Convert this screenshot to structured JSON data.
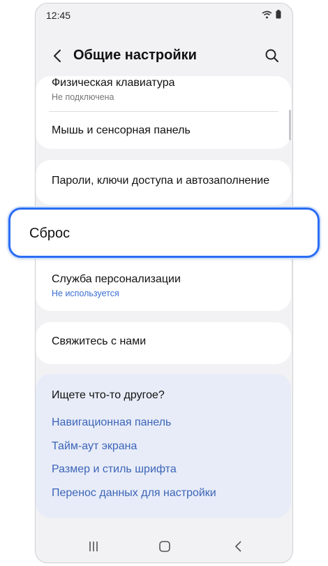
{
  "status_bar": {
    "time": "12:45"
  },
  "app_bar": {
    "title": "Общие настройки"
  },
  "items": {
    "keyboard": {
      "label": "Физическая клавиатура",
      "sub": "Не подключена"
    },
    "mouse": {
      "label": "Мышь и сенсорная панель"
    },
    "passwords": {
      "label": "Пароли, ключи доступа и автозаполнение"
    },
    "reset": {
      "label": "Сброс"
    },
    "personalization": {
      "label": "Служба персонализации",
      "sub": "Не используется"
    },
    "contact": {
      "label": "Свяжитесь с нами"
    }
  },
  "suggestions": {
    "heading": "Ищете что-то другое?",
    "links": [
      "Навигационная панель",
      "Тайм-аут экрана",
      "Размер и стиль шрифта",
      "Перенос данных для настройки"
    ]
  },
  "colors": {
    "accent": "#2a6df2",
    "link": "#3d64b8",
    "background": "#f2f2f4"
  }
}
